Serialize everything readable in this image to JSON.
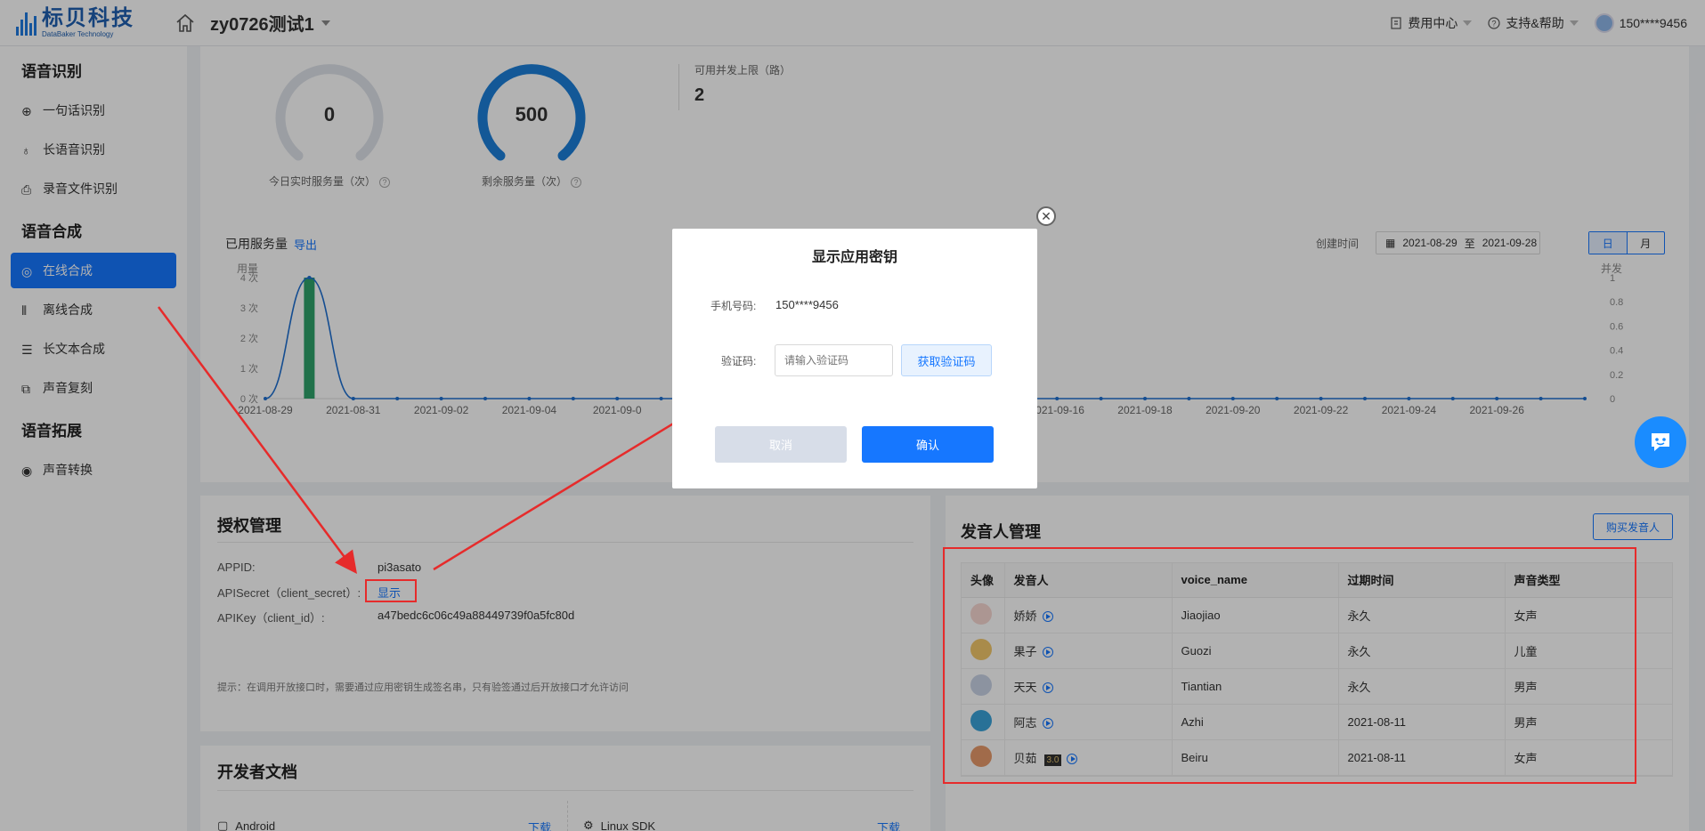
{
  "header": {
    "logo_cn": "标贝科技",
    "logo_en": "DataBaker Technology",
    "app_name": "zy0726测试1",
    "fee_center": "费用中心",
    "support": "支持&帮助",
    "user": "150****9456"
  },
  "sidebar": {
    "groups": [
      {
        "title": "语音识别",
        "items": [
          "一句话识别",
          "长语音识别",
          "录音文件识别"
        ]
      },
      {
        "title": "语音合成",
        "items": [
          "在线合成",
          "离线合成",
          "长文本合成",
          "声音复刻"
        ]
      },
      {
        "title": "语音拓展",
        "items": [
          "声音转换"
        ]
      }
    ],
    "active": "在线合成"
  },
  "stats": {
    "today_value": "0",
    "today_label": "今日实时服务量（次）",
    "remain_value": "500",
    "remain_label": "剩余服务量（次）",
    "concurrency_label": "可用并发上限（路）",
    "concurrency_value": "2"
  },
  "usage": {
    "title": "已用服务量",
    "export": "导出",
    "created_label": "创建时间",
    "date_from": "2021-08-29",
    "date_sep": "至",
    "date_to": "2021-09-28",
    "tab_day": "日",
    "tab_month": "月"
  },
  "chart_data": {
    "type": "line",
    "xlabel": "",
    "ylabel": "用量",
    "y2label": "并发",
    "y_ticks": [
      "0 次",
      "1 次",
      "2 次",
      "3 次",
      "4 次"
    ],
    "y2_ticks": [
      "0",
      "0.2",
      "0.4",
      "0.6",
      "0.8",
      "1"
    ],
    "ylim": [
      0,
      4
    ],
    "y2lim": [
      0,
      1
    ],
    "x_ticks": [
      "2021-08-29",
      "2021-08-31",
      "2021-09-02",
      "2021-09-04",
      "2021-09-0",
      "2021-09-16",
      "2021-09-18",
      "2021-09-20",
      "2021-09-22",
      "2021-09-24",
      "2021-09-26"
    ],
    "series": [
      {
        "values": [
          0,
          4,
          0,
          0,
          0,
          0,
          0,
          0,
          0,
          0,
          0,
          0,
          0,
          0,
          0,
          0,
          0,
          0,
          0,
          0,
          0,
          0,
          0,
          0,
          0,
          0,
          0,
          0,
          0,
          0,
          0
        ]
      }
    ],
    "bar_day_index": 1,
    "bar_value": 4
  },
  "auth": {
    "title": "授权管理",
    "appid_label": "APPID:",
    "appid": "pi3asato",
    "secret_label": "APISecret（client_secret）:",
    "secret_show": "显示",
    "key_label": "APIKey（client_id）:",
    "key": "a47bedc6c06c49a88449739f0a5fc80d",
    "tip": "提示：在调用开放接口时，需要通过应用密钥生成签名串，只有验签通过后开放接口才允许访问"
  },
  "docs": {
    "title": "开发者文档",
    "items": [
      {
        "name": "Android",
        "action": "下载"
      },
      {
        "name": "Linux SDK",
        "action": "下载"
      }
    ]
  },
  "voices": {
    "title": "发音人管理",
    "buy": "购买发音人",
    "columns": [
      "头像",
      "发音人",
      "voice_name",
      "过期时间",
      "声音类型"
    ],
    "rows": [
      {
        "name": "娇娇",
        "voice": "Jiaojiao",
        "expire": "永久",
        "type": "女声",
        "tag": ""
      },
      {
        "name": "果子",
        "voice": "Guozi",
        "expire": "永久",
        "type": "儿童",
        "tag": ""
      },
      {
        "name": "天天",
        "voice": "Tiantian",
        "expire": "永久",
        "type": "男声",
        "tag": ""
      },
      {
        "name": "阿志",
        "voice": "Azhi",
        "expire": "2021-08-11",
        "type": "男声",
        "tag": ""
      },
      {
        "name": "贝茹",
        "voice": "Beiru",
        "expire": "2021-08-11",
        "type": "女声",
        "tag": "3.0"
      }
    ]
  },
  "modal": {
    "title": "显示应用密钥",
    "phone_label": "手机号码:",
    "phone": "150****9456",
    "code_label": "验证码:",
    "code_placeholder": "请输入验证码",
    "get_code": "获取验证码",
    "cancel": "取消",
    "confirm": "确认"
  }
}
